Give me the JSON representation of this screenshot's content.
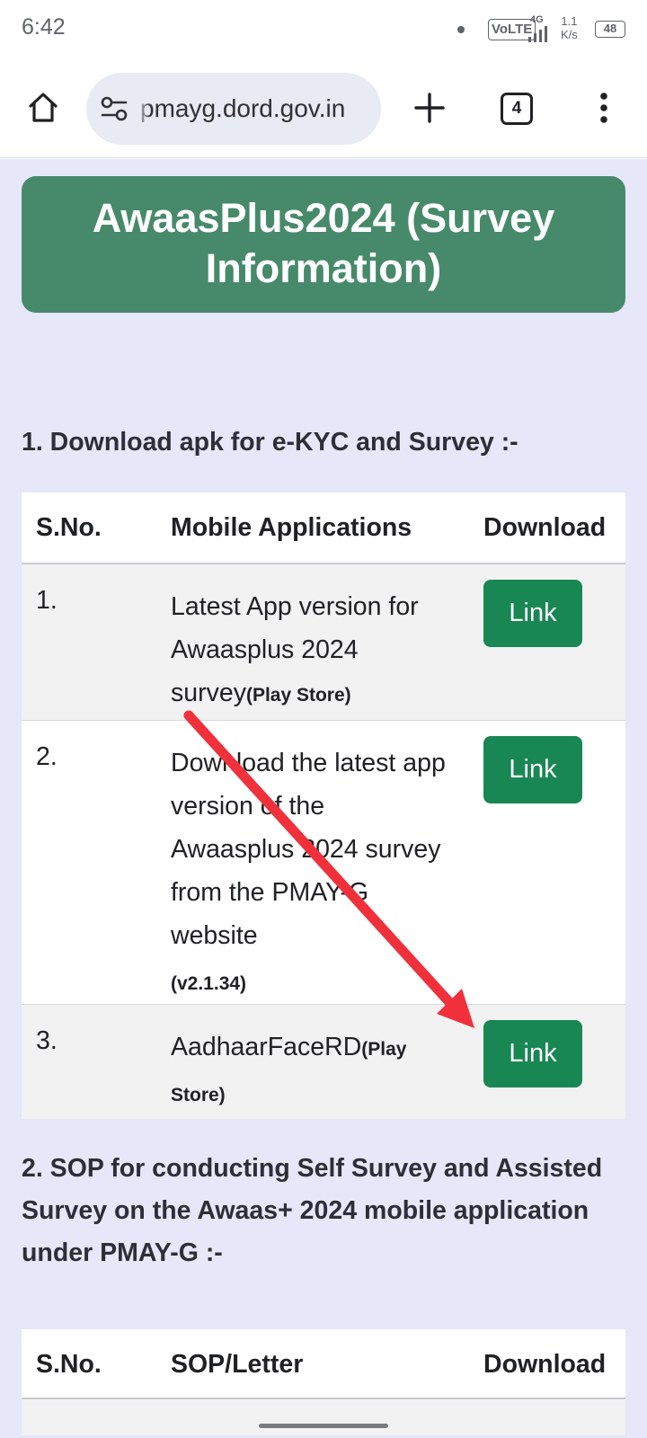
{
  "status_bar": {
    "time": "6:42",
    "volte": "VoLTE",
    "network": "4G",
    "speed_value": "1.1",
    "speed_unit": "K/s",
    "battery": "48"
  },
  "browser": {
    "url": "pmayg.dord.gov.in",
    "tab_count": "4"
  },
  "page": {
    "title": "AwaasPlus2024 (Survey Information)",
    "section1": {
      "heading": "1. Download apk for e-KYC and Survey :-",
      "columns": [
        "S.No.",
        "Mobile Applications",
        "Download"
      ],
      "rows": [
        {
          "sno": "1.",
          "text": "Latest App version for Awaasplus 2024 survey",
          "note": "(Play Store)",
          "button": "Link"
        },
        {
          "sno": "2.",
          "text": "Download the latest app version of the Awaasplus 2024 survey from the PMAY-G website",
          "note": "(v2.1.34)",
          "button": "Link"
        },
        {
          "sno": "3.",
          "text": "AadhaarFaceRD",
          "note": "(Play Store)",
          "button": "Link"
        }
      ]
    },
    "section2": {
      "heading": "2. SOP for conducting Self Survey and Assisted Survey on the Awaas+ 2024 mobile application under PMAY-G :-",
      "columns": [
        "S.No.",
        "SOP/Letter",
        "Download"
      ]
    }
  },
  "annotation": {
    "arrow_color": "#f0303a"
  },
  "icons": {
    "home": "home-icon",
    "site_settings": "tune-icon",
    "new_tab": "plus-icon",
    "tabs": "tab-switcher-icon",
    "menu": "more-vert-icon"
  }
}
